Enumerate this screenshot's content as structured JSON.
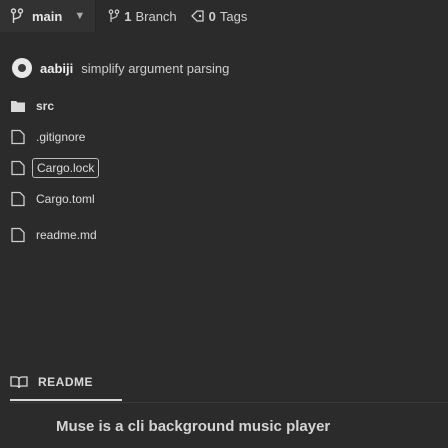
{
  "topbar": {
    "branch_name": "main",
    "branch_count": "1",
    "branch_label": "Branch",
    "tag_count": "0",
    "tag_label": "Tags"
  },
  "commit": {
    "author": "aabiji",
    "message": "simplify argument parsing"
  },
  "files": [
    {
      "name": "src",
      "type": "folder",
      "icon": "folder-icon"
    },
    {
      "name": ".gitignore",
      "type": "file",
      "icon": "file-icon"
    },
    {
      "name": "Cargo.lock",
      "type": "file",
      "icon": "file-icon",
      "selected": true
    },
    {
      "name": "Cargo.toml",
      "type": "file",
      "icon": "file-icon"
    },
    {
      "name": "readme.md",
      "type": "file",
      "icon": "file-icon"
    }
  ],
  "readme": {
    "tab_label": "README",
    "heading": "Muse is a cli background music player"
  },
  "colors": {
    "background": "#2b2b2b",
    "text": "#d9d9d9",
    "branch_bar": "#323232"
  }
}
